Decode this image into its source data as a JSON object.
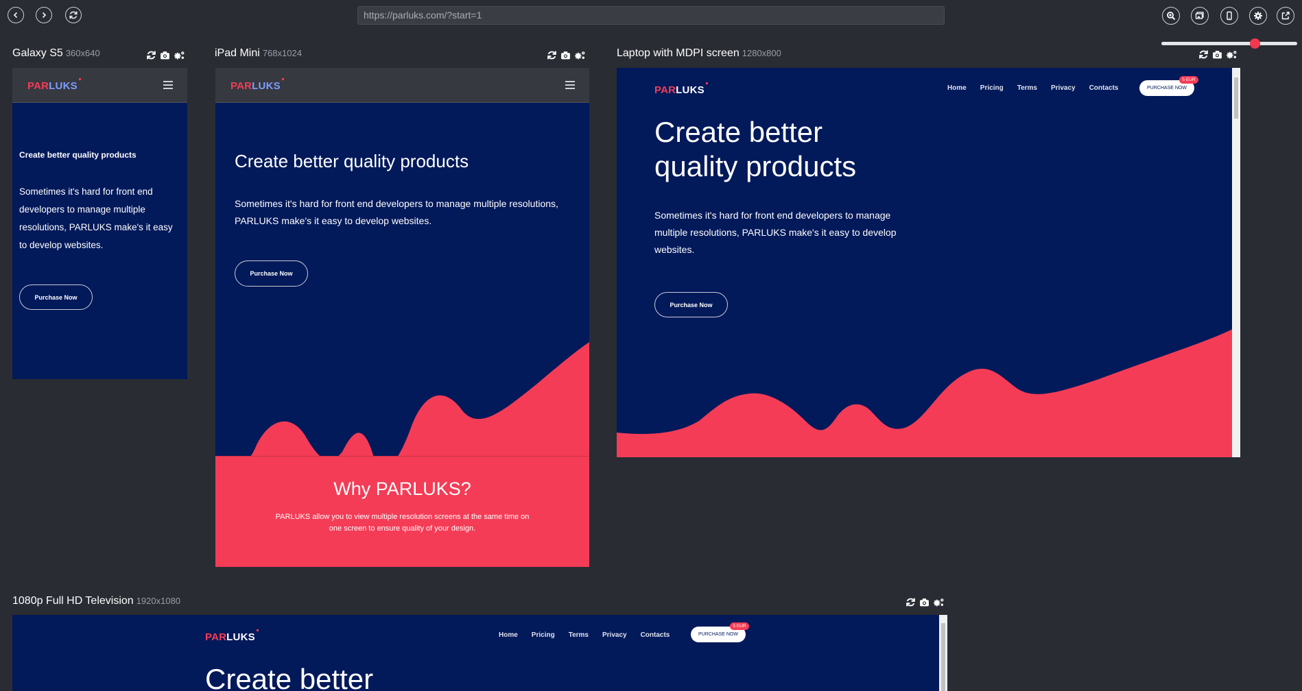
{
  "toolbar": {
    "url": "https://parluks.com/?start=1",
    "back_icon": "chevron-left-icon",
    "forward_icon": "chevron-right-icon",
    "reload_icon": "refresh-icon",
    "tools": [
      "zoom-icon",
      "screenshots-icon",
      "device-icon",
      "settings-icon",
      "external-link-icon"
    ],
    "zoom_slider_value": 0.7
  },
  "devices": [
    {
      "name": "Galaxy S5",
      "resolution": "360x640",
      "logo_par": "PAR",
      "logo_luks": "LUKS",
      "hero_title": "Create better quality products",
      "hero_text": "Sometimes it's hard for front end developers to manage multiple resolutions, PARLUKS make's it easy to develop websites.",
      "button": "Purchase Now"
    },
    {
      "name": "iPad Mini",
      "resolution": "768x1024",
      "logo_par": "PAR",
      "logo_luks": "LUKS",
      "hero_title": "Create better quality products",
      "hero_text": "Sometimes it's hard for front end developers to manage multiple resolutions, PARLUKS make's it easy to develop websites.",
      "button": "Purchase Now",
      "section_title": "Why PARLUKS?",
      "section_text": "PARLUKS allow you to view multiple resolution screens at the same time on one screen to ensure quality of your design."
    },
    {
      "name": "Laptop with MDPI screen",
      "resolution": "1280x800",
      "logo_par": "PAR",
      "logo_luks": "LUKS",
      "nav": [
        "Home",
        "Pricing",
        "Terms",
        "Privacy",
        "Contacts"
      ],
      "purchase": "PURCHASE NOW",
      "badge": "5 EUR",
      "hero_title_1": "Create better",
      "hero_title_2": "quality products",
      "hero_text": "Sometimes it's hard for front end developers to manage multiple resolutions, PARLUKS make's it easy to develop websites.",
      "button": "Purchase Now"
    },
    {
      "name": "1080p Full HD Television",
      "resolution": "1920x1080",
      "logo_par": "PAR",
      "logo_luks": "LUKS",
      "nav": [
        "Home",
        "Pricing",
        "Terms",
        "Privacy",
        "Contacts"
      ],
      "purchase": "PURCHASE NOW",
      "badge": "5 EUR",
      "hero_title_1": "Create better"
    }
  ],
  "device_actions": [
    "refresh-icon",
    "camera-icon",
    "cogs-icon"
  ],
  "colors": {
    "background": "#292c33",
    "site_navy": "#02195a",
    "site_red": "#f43c56",
    "accent": "#f0384f"
  }
}
